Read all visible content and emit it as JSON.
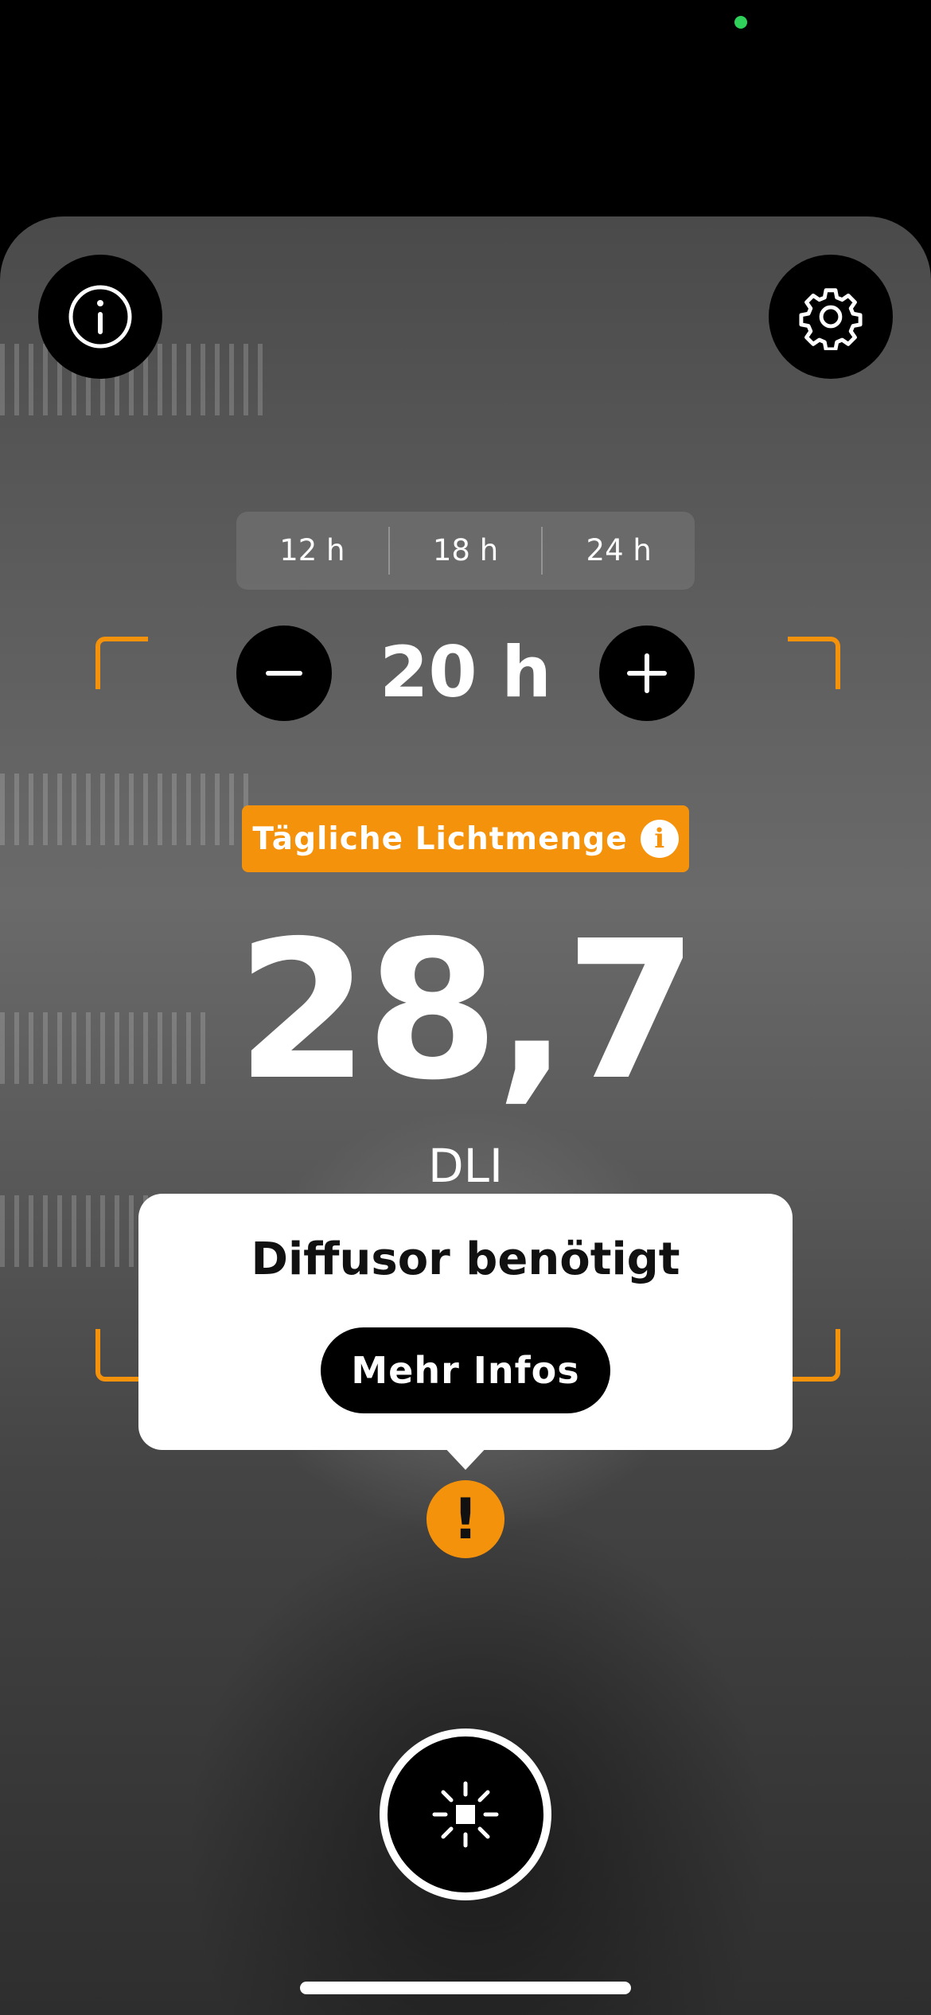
{
  "durations": {
    "presets": [
      "12 h",
      "18 h",
      "24 h"
    ],
    "current": "20 h"
  },
  "result": {
    "badge_label": "Tägliche Lichtmenge",
    "value": "28,7",
    "unit": "DLI"
  },
  "popup": {
    "title": "Diffusor benötigt",
    "button_label": "Mehr Infos"
  },
  "colors": {
    "accent": "#f5920b",
    "status_dot": "#2fd15a",
    "button_bg": "#000000"
  },
  "icons": {
    "top_left": "info-icon",
    "top_right": "gear-icon",
    "minus": "minus-icon",
    "plus": "plus-icon",
    "warning": "exclamation-icon",
    "capture": "light-sensor-icon"
  }
}
